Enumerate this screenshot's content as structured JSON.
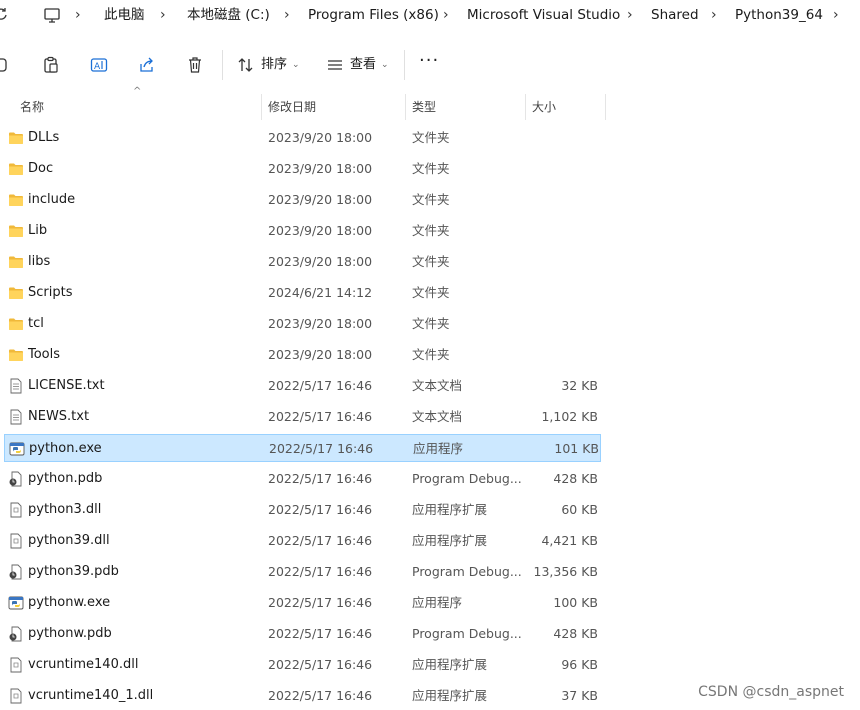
{
  "address_bar": {
    "segments": [
      "此电脑",
      "本地磁盘 (C:)",
      "Program Files (x86)",
      "Microsoft Visual Studio",
      "Shared",
      "Python39_64"
    ]
  },
  "toolbar": {
    "sort_label": "排序",
    "view_label": "查看",
    "more_label": "···"
  },
  "columns": {
    "name": "名称",
    "date": "修改日期",
    "type": "类型",
    "size": "大小"
  },
  "files": [
    {
      "name": "DLLs",
      "date": "2023/9/20 18:00",
      "type": "文件夹",
      "size": "",
      "icon": "folder-icon"
    },
    {
      "name": "Doc",
      "date": "2023/9/20 18:00",
      "type": "文件夹",
      "size": "",
      "icon": "folder-icon"
    },
    {
      "name": "include",
      "date": "2023/9/20 18:00",
      "type": "文件夹",
      "size": "",
      "icon": "folder-icon"
    },
    {
      "name": "Lib",
      "date": "2023/9/20 18:00",
      "type": "文件夹",
      "size": "",
      "icon": "folder-icon"
    },
    {
      "name": "libs",
      "date": "2023/9/20 18:00",
      "type": "文件夹",
      "size": "",
      "icon": "folder-icon"
    },
    {
      "name": "Scripts",
      "date": "2024/6/21 14:12",
      "type": "文件夹",
      "size": "",
      "icon": "folder-icon"
    },
    {
      "name": "tcl",
      "date": "2023/9/20 18:00",
      "type": "文件夹",
      "size": "",
      "icon": "folder-icon"
    },
    {
      "name": "Tools",
      "date": "2023/9/20 18:00",
      "type": "文件夹",
      "size": "",
      "icon": "folder-icon"
    },
    {
      "name": "LICENSE.txt",
      "date": "2022/5/17 16:46",
      "type": "文本文档",
      "size": "32 KB",
      "icon": "text-file-icon"
    },
    {
      "name": "NEWS.txt",
      "date": "2022/5/17 16:46",
      "type": "文本文档",
      "size": "1,102 KB",
      "icon": "text-file-icon"
    },
    {
      "name": "python.exe",
      "date": "2022/5/17 16:46",
      "type": "应用程序",
      "size": "101 KB",
      "icon": "python-exe-icon",
      "selected": true
    },
    {
      "name": "python.pdb",
      "date": "2022/5/17 16:46",
      "type": "Program Debug...",
      "size": "428 KB",
      "icon": "pdb-file-icon"
    },
    {
      "name": "python3.dll",
      "date": "2022/5/17 16:46",
      "type": "应用程序扩展",
      "size": "60 KB",
      "icon": "dll-file-icon"
    },
    {
      "name": "python39.dll",
      "date": "2022/5/17 16:46",
      "type": "应用程序扩展",
      "size": "4,421 KB",
      "icon": "dll-file-icon"
    },
    {
      "name": "python39.pdb",
      "date": "2022/5/17 16:46",
      "type": "Program Debug...",
      "size": "13,356 KB",
      "icon": "pdb-file-icon"
    },
    {
      "name": "pythonw.exe",
      "date": "2022/5/17 16:46",
      "type": "应用程序",
      "size": "100 KB",
      "icon": "python-exe-icon"
    },
    {
      "name": "pythonw.pdb",
      "date": "2022/5/17 16:46",
      "type": "Program Debug...",
      "size": "428 KB",
      "icon": "pdb-file-icon"
    },
    {
      "name": "vcruntime140.dll",
      "date": "2022/5/17 16:46",
      "type": "应用程序扩展",
      "size": "96 KB",
      "icon": "dll-file-icon"
    },
    {
      "name": "vcruntime140_1.dll",
      "date": "2022/5/17 16:46",
      "type": "应用程序扩展",
      "size": "37 KB",
      "icon": "dll-file-icon"
    }
  ],
  "watermark": "CSDN @csdn_aspnet",
  "colors": {
    "folder": "#f7c948",
    "selection_bg": "#cce8ff",
    "selection_border": "#99d1ff"
  }
}
